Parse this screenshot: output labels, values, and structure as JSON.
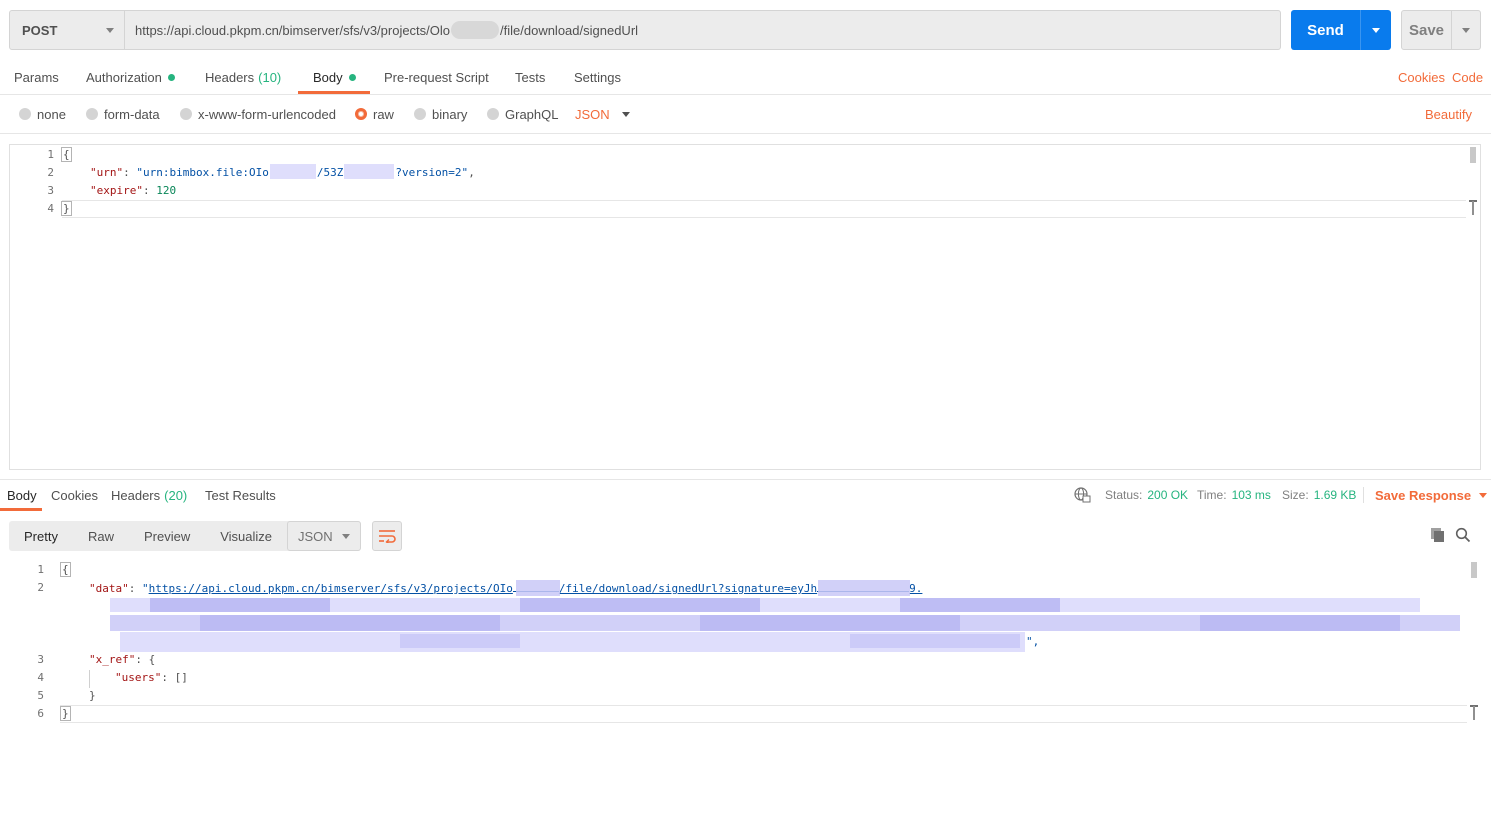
{
  "request": {
    "method": "POST",
    "url_prefix": "https://api.cloud.pkpm.cn/bimserver/sfs/v3/projects/Olo",
    "url_suffix": "/file/download/signedUrl",
    "send_label": "Send",
    "save_label": "Save"
  },
  "request_tabs": [
    {
      "label": "Params"
    },
    {
      "label": "Authorization"
    },
    {
      "label": "Headers",
      "count": "(10)"
    },
    {
      "label": "Body"
    },
    {
      "label": "Pre-request Script"
    },
    {
      "label": "Tests"
    },
    {
      "label": "Settings"
    }
  ],
  "right_links": {
    "cookies": "Cookies",
    "code": "Code"
  },
  "body_types": {
    "none": "none",
    "form_data": "form-data",
    "urlencoded": "x-www-form-urlencoded",
    "raw": "raw",
    "binary": "binary",
    "graphql": "GraphQL",
    "format": "JSON",
    "beautify": "Beautify"
  },
  "request_body": {
    "line_numbers": [
      "1",
      "2",
      "3",
      "4"
    ],
    "open_brace": "{",
    "urn_key": "\"urn\"",
    "urn_value_a": "\"urn:bimbox.file:OIo",
    "urn_value_b": "/53Z",
    "urn_value_c": "?version=2\"",
    "expire_key": "\"expire\"",
    "expire_value": "120",
    "close_brace": "}"
  },
  "response_tabs": [
    {
      "label": "Body"
    },
    {
      "label": "Cookies"
    },
    {
      "label": "Headers",
      "count": "(20)"
    },
    {
      "label": "Test Results"
    }
  ],
  "response_meta": {
    "status_label": "Status:",
    "status_value": "200 OK",
    "time_label": "Time:",
    "time_value": "103 ms",
    "size_label": "Size:",
    "size_value": "1.69 KB",
    "save_response": "Save Response"
  },
  "view_modes": [
    "Pretty",
    "Raw",
    "Preview",
    "Visualize"
  ],
  "response_format": "JSON",
  "response_body": {
    "line_numbers": [
      "1",
      "2",
      "3",
      "4",
      "5",
      "6"
    ],
    "open_brace": "{",
    "data_key": "\"data\"",
    "data_link_a": "https://api.cloud.pkpm.cn/bimserver/sfs/v3/projects/OIo",
    "data_link_b": "/file/download/signedUrl?signature=eyJh",
    "data_link_c": "9.",
    "data_tail_end": "\",",
    "xref_key": "\"x_ref\"",
    "xref_open": "{",
    "users_key": "\"users\"",
    "users_value": "[]",
    "xref_close": "}",
    "close_brace": "}"
  },
  "icons": [
    "chevron-down-icon",
    "globe-icon",
    "copy-icon",
    "search-icon",
    "wrap-lines-icon"
  ],
  "colors": {
    "accent": "#f26b3a",
    "send": "#097bed",
    "ok": "#26b47f"
  }
}
